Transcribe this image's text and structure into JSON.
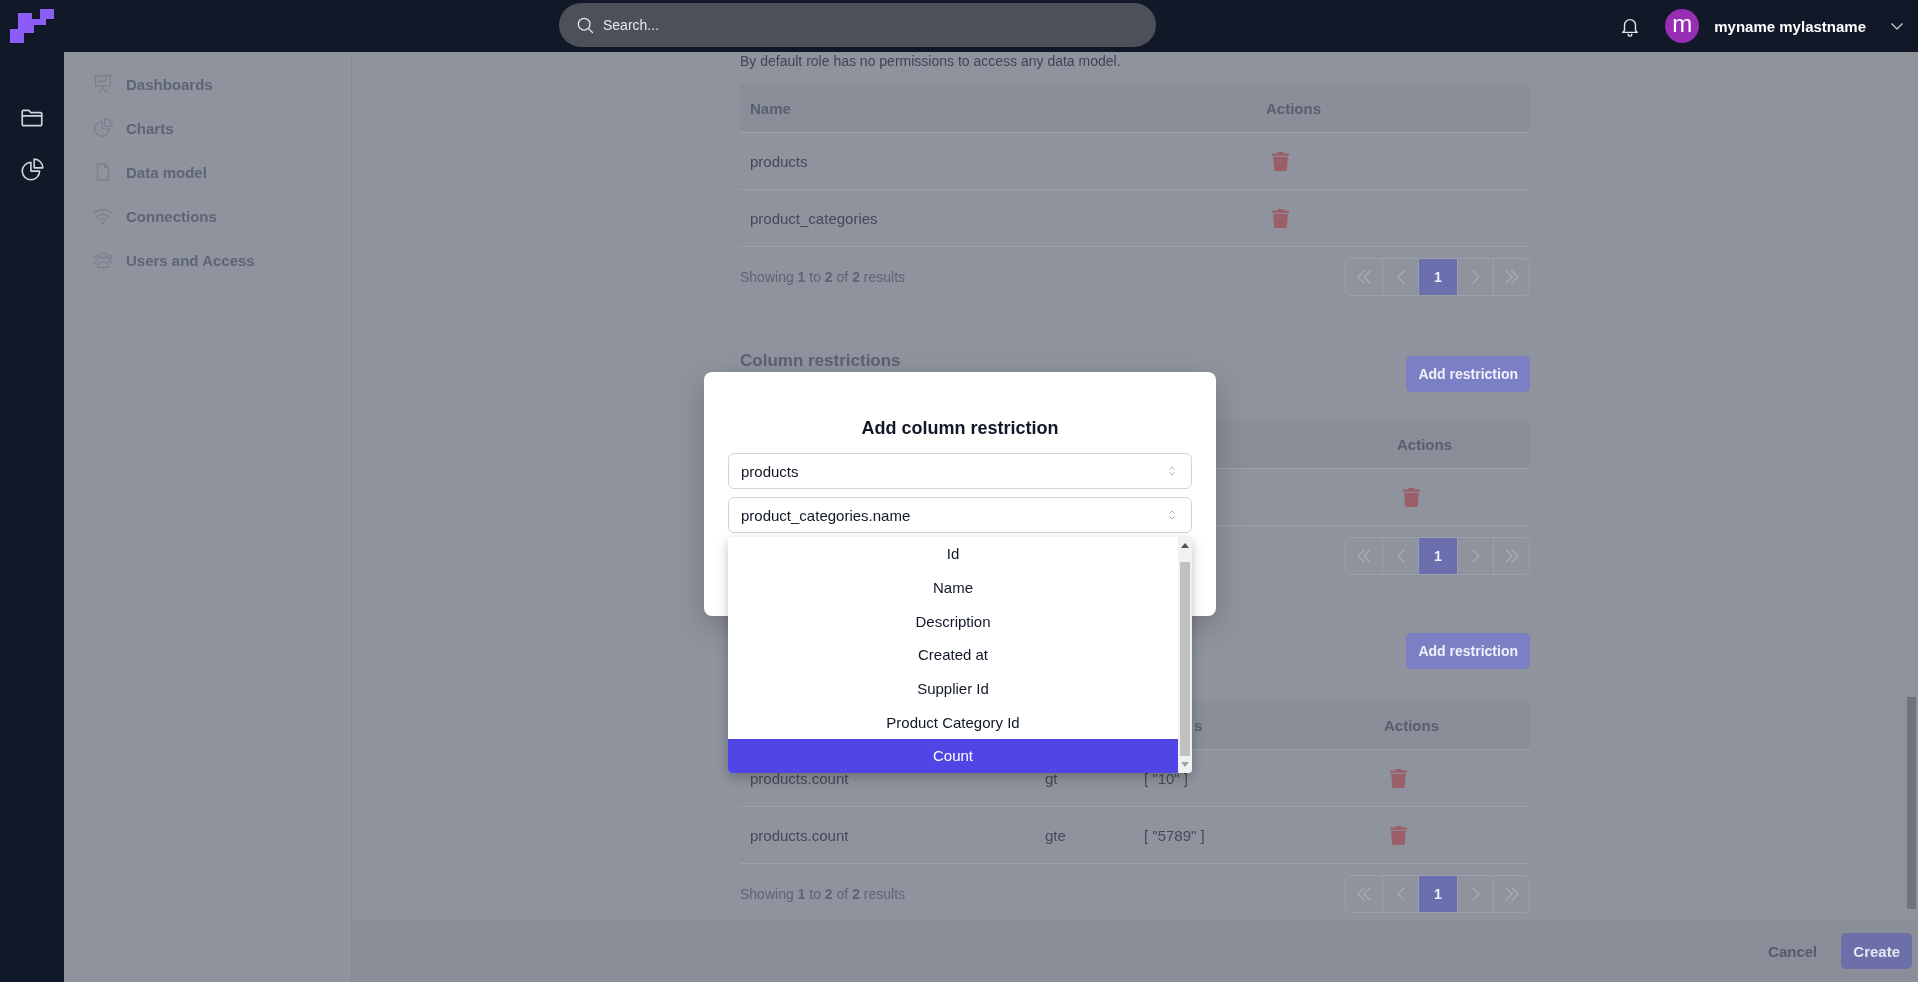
{
  "top_bar": {
    "search": {
      "placeholder": "Search..."
    },
    "user": {
      "avatar_letter": "m",
      "name": "myname mylastname"
    }
  },
  "sidebar": {
    "items": [
      {
        "label": "Dashboards"
      },
      {
        "label": "Charts"
      },
      {
        "label": "Data model"
      },
      {
        "label": "Connections"
      },
      {
        "label": "Users and Access"
      }
    ]
  },
  "content": {
    "description": "By default role has no permissions to access any data model.",
    "model_table": {
      "columns": [
        {
          "label": "Name"
        },
        {
          "label": "Actions"
        }
      ],
      "rows": [
        {
          "cells": [
            "products"
          ],
          "deletable": true
        },
        {
          "cells": [
            "product_categories"
          ],
          "deletable": true
        }
      ],
      "summary": "Showing **1** to **2** of **2** results",
      "pager": [
        {
          "kind": "first"
        },
        {
          "kind": "prev"
        },
        {
          "kind": "page",
          "label": "1",
          "selected": true
        },
        {
          "kind": "next"
        },
        {
          "kind": "last"
        }
      ]
    },
    "column_restrictions": {
      "title": "Column restrictions",
      "add_button": "Add restriction",
      "columns": [
        {
          "label": "Actions"
        }
      ],
      "rows": [
        {
          "deletable": true
        }
      ],
      "pager": [
        {
          "kind": "first"
        },
        {
          "kind": "prev"
        },
        {
          "kind": "page",
          "label": "1",
          "selected": true
        },
        {
          "kind": "next"
        },
        {
          "kind": "last"
        }
      ]
    },
    "row_restrictions": {
      "add_button": "Add restriction",
      "columns": [
        {
          "label": "s"
        },
        {
          "label": "Actions"
        }
      ],
      "rows": [
        {
          "cells": [
            "products.count",
            "gt",
            "[ \"10\" ]"
          ],
          "deletable": true
        },
        {
          "cells": [
            "products.count",
            "gte",
            "[ \"5789\" ]"
          ],
          "deletable": true
        }
      ],
      "summary": "Showing **1** to **2** of **2** results",
      "pager": [
        {
          "kind": "first"
        },
        {
          "kind": "prev"
        },
        {
          "kind": "page",
          "label": "1",
          "selected": true
        },
        {
          "kind": "next"
        },
        {
          "kind": "last"
        }
      ]
    }
  },
  "footer": {
    "cancel": "Cancel",
    "create": "Create"
  },
  "modal": {
    "title": "Add column restriction",
    "selects": [
      {
        "value": "products"
      },
      {
        "value": "product_categories.name"
      }
    ],
    "dropdown": {
      "options": [
        {
          "label": "Id",
          "selected": false
        },
        {
          "label": "Name",
          "selected": false
        },
        {
          "label": "Description",
          "selected": false
        },
        {
          "label": "Created at",
          "selected": false
        },
        {
          "label": "Supplier Id",
          "selected": false
        },
        {
          "label": "Product Category Id",
          "selected": false
        },
        {
          "label": "Count",
          "selected": true
        }
      ]
    }
  }
}
